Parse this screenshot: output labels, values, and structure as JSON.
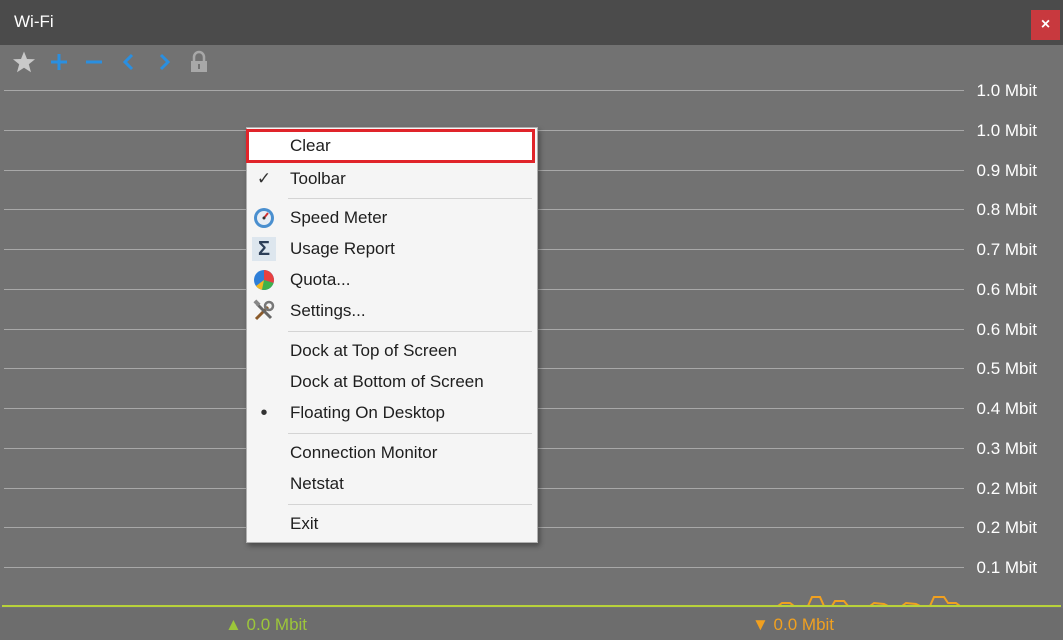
{
  "window": {
    "title": "Wi-Fi",
    "close_label": "×"
  },
  "toolbar": {
    "buttons": [
      {
        "name": "star-icon",
        "color": "#c9c9c9"
      },
      {
        "name": "plus-icon",
        "color": "#2a8fe0"
      },
      {
        "name": "minus-icon",
        "color": "#2a8fe0"
      },
      {
        "name": "chevron-left-icon",
        "color": "#2a8fe0"
      },
      {
        "name": "chevron-right-icon",
        "color": "#2a8fe0"
      },
      {
        "name": "lock-icon",
        "color": "#a8a8a8"
      }
    ]
  },
  "graph": {
    "y_labels": [
      "1.0 Mbit",
      "1.0 Mbit",
      "0.9 Mbit",
      "0.8 Mbit",
      "0.7 Mbit",
      "0.6 Mbit",
      "0.6 Mbit",
      "0.5 Mbit",
      "0.4 Mbit",
      "0.3 Mbit",
      "0.2 Mbit",
      "0.2 Mbit",
      "0.1 Mbit"
    ],
    "upload_color": "#b8d23a",
    "download_color": "#f0a020"
  },
  "status": {
    "upload": "▲ 0.0 Mbit",
    "download": "▼ 0.0 Mbit"
  },
  "context_menu": {
    "clear": "Clear",
    "toolbar": "Toolbar",
    "toolbar_check": "✓",
    "speed_meter": "Speed Meter",
    "usage_report": "Usage Report",
    "usage_report_icon": "Σ",
    "quota": "Quota...",
    "settings": "Settings...",
    "dock_top": "Dock at Top of Screen",
    "dock_bottom": "Dock at Bottom of Screen",
    "floating": "Floating On Desktop",
    "floating_bullet": "•",
    "connection_monitor": "Connection Monitor",
    "netstat": "Netstat",
    "exit": "Exit",
    "highlight_color": "#e0242a"
  }
}
